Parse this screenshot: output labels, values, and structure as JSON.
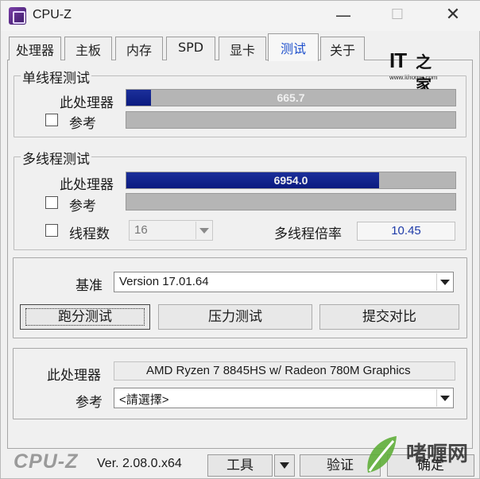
{
  "window": {
    "title": "CPU-Z",
    "minimize": "—",
    "maximize": "☐",
    "close": "✕"
  },
  "tabs": [
    {
      "label": "处理器",
      "active": false
    },
    {
      "label": "主板",
      "active": false
    },
    {
      "label": "内存",
      "active": false
    },
    {
      "label": "SPD",
      "active": false
    },
    {
      "label": "显卡",
      "active": false
    },
    {
      "label": "测试",
      "active": true
    },
    {
      "label": "关于",
      "active": false
    }
  ],
  "logo": {
    "main": "IT",
    "zh": "之家",
    "url": "www.ithome.com"
  },
  "single_thread": {
    "title": "单线程测试",
    "this_cpu_label": "此处理器",
    "this_cpu_score": "665.7",
    "this_cpu_fill_fraction": 0.074,
    "reference_label": "参考",
    "reference_checked": false,
    "reference_score": ""
  },
  "multi_thread": {
    "title": "多线程测试",
    "this_cpu_label": "此处理器",
    "this_cpu_score": "6954.0",
    "this_cpu_fill_fraction": 0.768,
    "reference_label": "参考",
    "reference_checked": false,
    "threads_label": "线程数",
    "threads_checked": false,
    "threads_value": "16",
    "ratio_label": "多线程倍率",
    "ratio_value": "10.45"
  },
  "benchmark": {
    "baseline_label": "基准",
    "baseline_value": "Version 17.01.64",
    "buttons": {
      "bench": "跑分测试",
      "stress": "压力测试",
      "submit": "提交对比"
    }
  },
  "info": {
    "this_cpu_label": "此处理器",
    "this_cpu_name": "AMD Ryzen 7 8845HS w/ Radeon 780M Graphics",
    "reference_label": "参考",
    "reference_value": "<請選擇>"
  },
  "footer": {
    "logo": "CPU-Z",
    "version": "Ver. 2.08.0.x64",
    "tools": "工具",
    "verify": "验证",
    "ok": "确定"
  },
  "watermark": {
    "text": "啫喱网"
  },
  "colors": {
    "bar_fill": "#0b1a80",
    "bar_bg": "#b5b5b5",
    "active_tab": "#1d4fcc",
    "ratio_text": "#1d3aa8"
  }
}
